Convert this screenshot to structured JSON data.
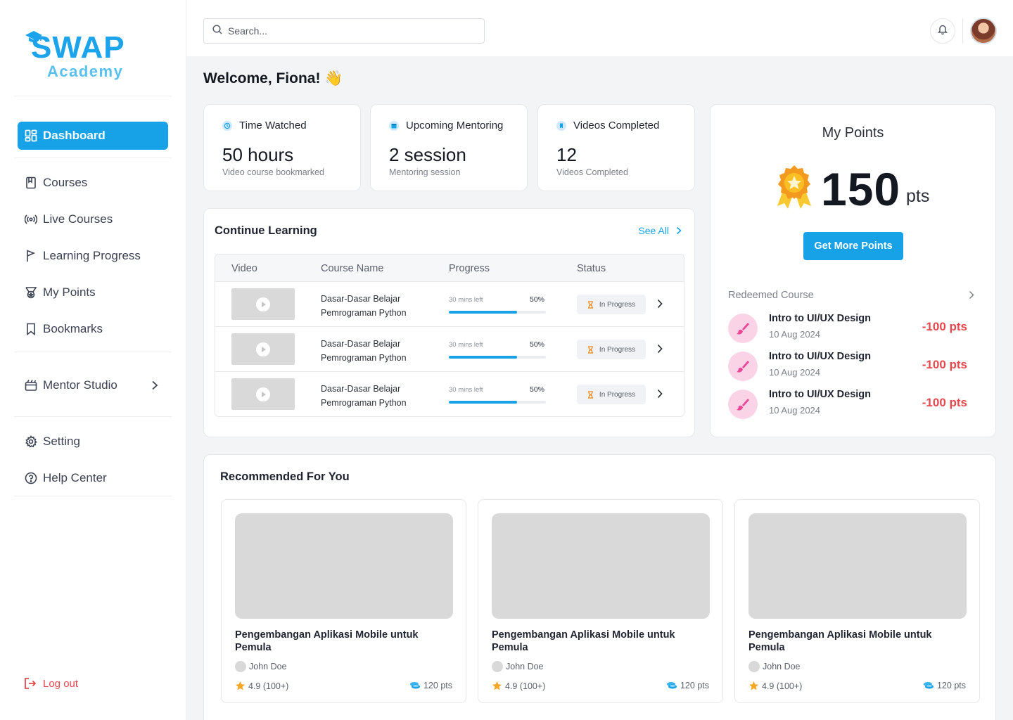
{
  "brand": {
    "name_line1": "SWAP",
    "name_line2": "Academy"
  },
  "sidebar": {
    "items": [
      {
        "label": "Dashboard",
        "icon": "dashboard-icon",
        "active": true
      },
      {
        "label": "Courses",
        "icon": "book-icon"
      },
      {
        "label": "Live Courses",
        "icon": "broadcast-icon"
      },
      {
        "label": "Learning Progress",
        "icon": "flag-icon"
      },
      {
        "label": "My Points",
        "icon": "medal-icon"
      },
      {
        "label": "Bookmarks",
        "icon": "bookmark-icon"
      },
      {
        "label": "Mentor Studio",
        "icon": "studio-icon"
      },
      {
        "label": "Setting",
        "icon": "gear-icon"
      },
      {
        "label": "Help Center",
        "icon": "help-icon"
      }
    ],
    "logout": "Log out"
  },
  "header": {
    "search_placeholder": "Search..."
  },
  "welcome": "Welcome, Fiona! 👋",
  "stats": [
    {
      "title": "Time Watched",
      "value": "50 hours",
      "sub": "Video course bookmarked",
      "color": "#8fcdf5"
    },
    {
      "title": "Upcoming Mentoring",
      "value": "2 session",
      "sub": "Mentoring session",
      "color": "#17a2e8"
    },
    {
      "title": "Videos Completed",
      "value": "12",
      "sub": "Videos Completed",
      "color": "#17a2e8"
    }
  ],
  "continue_learning": {
    "title": "Continue Learning",
    "see_all": "See All",
    "columns": [
      "Video",
      "Course Name",
      "Progress",
      "Status"
    ],
    "rows": [
      {
        "course": "Dasar-Dasar Belajar Pemrograman Python",
        "time_left": "30 mins left",
        "percent_label": "50%",
        "progress": 0.7,
        "status": "In Progress"
      },
      {
        "course": "Dasar-Dasar Belajar Pemrograman Python",
        "time_left": "30 mins left",
        "percent_label": "50%",
        "progress": 0.7,
        "status": "In Progress"
      },
      {
        "course": "Dasar-Dasar Belajar Pemrograman Python",
        "time_left": "30 mins left",
        "percent_label": "50%",
        "progress": 0.7,
        "status": "In Progress"
      }
    ]
  },
  "points": {
    "title": "My Points",
    "value": "150",
    "unit": "pts",
    "button": "Get More Points",
    "redeemed_title": "Redeemed Course",
    "redeemed": [
      {
        "name": "Intro to UI/UX Design",
        "date": "10 Aug 2024",
        "points": "-100 pts"
      },
      {
        "name": "Intro to UI/UX Design",
        "date": "10 Aug 2024",
        "points": "-100 pts"
      },
      {
        "name": "Intro to UI/UX Design",
        "date": "10 Aug 2024",
        "points": "-100 pts"
      }
    ]
  },
  "recommended": {
    "title": "Recommended For You",
    "cards": [
      {
        "name": "Pengembangan Aplikasi Mobile untuk Pemula",
        "author": "John Doe",
        "rating": "4.9 (100+)",
        "points": "120 pts"
      },
      {
        "name": "Pengembangan Aplikasi Mobile untuk Pemula",
        "author": "John Doe",
        "rating": "4.9 (100+)",
        "points": "120 pts"
      },
      {
        "name": "Pengembangan Aplikasi Mobile untuk Pemula",
        "author": "John Doe",
        "rating": "4.9 (100+)",
        "points": "120 pts"
      }
    ]
  },
  "colors": {
    "accent": "#17a2e8",
    "danger": "#e5484d",
    "status_icon": "#f08a24"
  }
}
